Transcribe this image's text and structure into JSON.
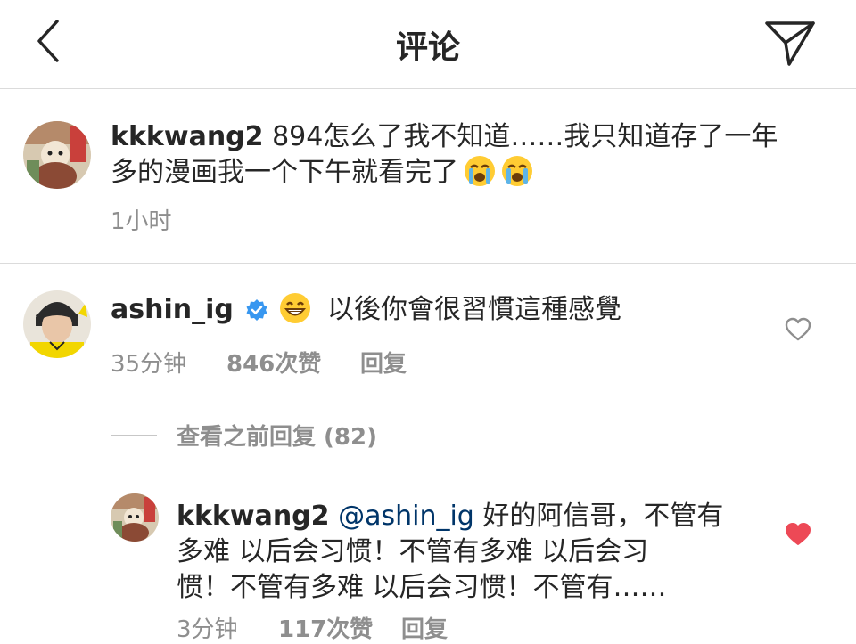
{
  "header": {
    "title": "评论"
  },
  "caption": {
    "username": "kkkwang2",
    "text_line1": "894怎么了我不知道……我只知道存了一年",
    "text_line2": "多的漫画我一个下午就看完了",
    "emojis": [
      "loudly-crying-face",
      "loudly-crying-face"
    ],
    "time": "1小时"
  },
  "comment": {
    "username": "ashin_ig",
    "verified": true,
    "emoji": "grinning-face",
    "text": "以後你會很習慣這種感覺",
    "time": "35分钟",
    "likes": "846次赞",
    "reply_label": "回复",
    "liked": false
  },
  "view_replies": {
    "label": "查看之前回复 (82)"
  },
  "reply": {
    "username": "kkkwang2",
    "mention": "@ashin_ig",
    "text_line1": "好的阿信哥，不管有",
    "text_line2": "多难 以后会习惯！不管有多难 以后会习",
    "text_line3": "惯！不管有多难 以后会习惯！不管有……",
    "time": "3分钟",
    "likes": "117次赞",
    "reply_label": "回复",
    "liked": true
  },
  "colors": {
    "text": "#262626",
    "secondary": "#8e8e8e",
    "divider": "#dbdbdb",
    "like_red": "#ed4956",
    "verified_blue": "#3897f0"
  }
}
